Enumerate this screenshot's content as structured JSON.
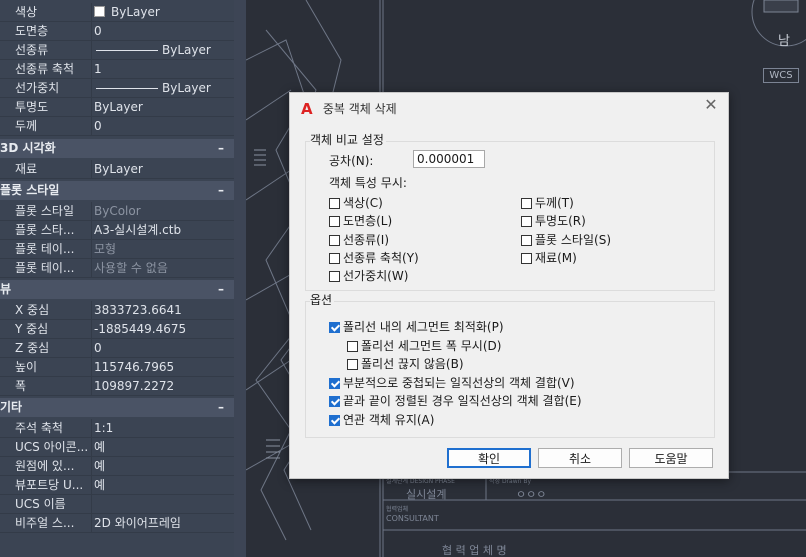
{
  "properties": {
    "general_rows": [
      {
        "key": "색상",
        "value": "ByLayer",
        "swatch": true
      },
      {
        "key": "도면층",
        "value": "0"
      },
      {
        "key": "선종류",
        "value": "ByLayer",
        "linetype": true
      },
      {
        "key": "선종류 축척",
        "value": "1"
      },
      {
        "key": "선가중치",
        "value": "ByLayer",
        "linetype": true
      },
      {
        "key": "투명도",
        "value": "ByLayer"
      },
      {
        "key": "두께",
        "value": "0"
      }
    ],
    "sections": {
      "visual3d": "3D 시각화",
      "plotstyle": "플롯 스타일",
      "view": "뷰",
      "misc": "기타"
    },
    "visual3d_rows": [
      {
        "key": "재료",
        "value": "ByLayer"
      }
    ],
    "plotstyle_rows": [
      {
        "key": "플롯 스타일",
        "value": "ByColor",
        "dim": true
      },
      {
        "key": "플롯 스타...",
        "value": "A3-실시설계.ctb"
      },
      {
        "key": "플롯 테이...",
        "value": "모형",
        "dim": true
      },
      {
        "key": "플롯 테이...",
        "value": "사용할 수 없음",
        "dim": true
      }
    ],
    "view_rows": [
      {
        "key": "X 중심",
        "value": "3833723.6641"
      },
      {
        "key": "Y 중심",
        "value": "-1885449.4675"
      },
      {
        "key": "Z 중심",
        "value": "0"
      },
      {
        "key": "높이",
        "value": "115746.7965"
      },
      {
        "key": "폭",
        "value": "109897.2272"
      }
    ],
    "misc_rows": [
      {
        "key": "주석 축척",
        "value": "1:1"
      },
      {
        "key": "UCS 아이콘...",
        "value": "예"
      },
      {
        "key": "원점에 있...",
        "value": "예"
      },
      {
        "key": "뷰포트당 U...",
        "value": "예"
      },
      {
        "key": "UCS 이름",
        "value": ""
      },
      {
        "key": "비주얼 스...",
        "value": "2D 와이어프레임"
      }
    ],
    "collapse_symbol": "–"
  },
  "canvas": {
    "wcs_label": "WCS",
    "viewcube_dir": "남",
    "titleblock": {
      "design_phase": "실시설계",
      "drawn_by": "ㅇㅇㅇ",
      "consultant": "CONSULTANT",
      "design_phase_label": "설계단계 DESIGN PHASE",
      "drawn_label": "작성 Drawn By",
      "consultant_label": "협력업체",
      "bottom_text": "협 력 업 체 명"
    }
  },
  "dialog": {
    "logo": "A",
    "title": "중복 객체 삭제",
    "close": "✕",
    "compare_group": "객체 비교 설정",
    "tolerance_label": "공차(N):",
    "tolerance_value": "0.000001",
    "ignore_label": "객체 특성 무시:",
    "ignore_left": [
      {
        "label": "색상(C)",
        "checked": false
      },
      {
        "label": "도면층(L)",
        "checked": false
      },
      {
        "label": "선종류(I)",
        "checked": false
      },
      {
        "label": "선종류 축척(Y)",
        "checked": false
      },
      {
        "label": "선가중치(W)",
        "checked": false
      }
    ],
    "ignore_right": [
      {
        "label": "두께(T)",
        "checked": false
      },
      {
        "label": "투명도(R)",
        "checked": false
      },
      {
        "label": "플롯 스타일(S)",
        "checked": false
      },
      {
        "label": "재료(M)",
        "checked": false
      }
    ],
    "options_group": "옵션",
    "options": [
      {
        "label": "폴리선 내의 세그먼트 최적화(P)",
        "checked": true,
        "indent": false
      },
      {
        "label": "폴리선 세그먼트 폭 무시(D)",
        "checked": false,
        "indent": true
      },
      {
        "label": "폴리선 끊지 않음(B)",
        "checked": false,
        "indent": true
      },
      {
        "label": "부분적으로 중첩되는 일직선상의 객체 결합(V)",
        "checked": true,
        "indent": false
      },
      {
        "label": "끝과 끝이 정렬된 경우 일직선상의 객체 결합(E)",
        "checked": true,
        "indent": false
      },
      {
        "label": "연관 객체 유지(A)",
        "checked": true,
        "indent": false
      }
    ],
    "buttons": {
      "ok": "확인",
      "cancel": "취소",
      "help": "도움말"
    }
  }
}
